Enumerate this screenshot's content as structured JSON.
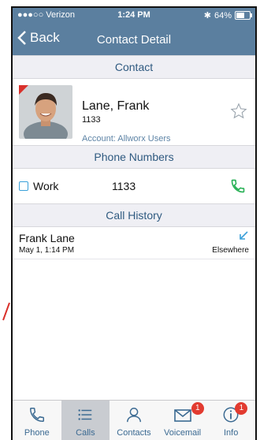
{
  "status_bar": {
    "carrier": "●●●○○ Verizon",
    "time": "1:24 PM",
    "battery": "64%",
    "battery_level": 0.64
  },
  "navbar": {
    "back_label": "Back",
    "title": "Contact Detail"
  },
  "contact_section": {
    "header": "Contact",
    "name": "Lane, Frank",
    "extension": "1133",
    "account": "Account: Allworx Users"
  },
  "phone_section": {
    "header": "Phone Numbers",
    "items": [
      {
        "type": "Work",
        "number": "1133"
      }
    ]
  },
  "history_section": {
    "header": "Call History",
    "items": [
      {
        "name": "Frank Lane",
        "date": "May 1, 1:14 PM",
        "location": "Elsewhere"
      }
    ]
  },
  "tabbar": {
    "tabs": [
      {
        "label": "Phone",
        "icon": "phone-icon"
      },
      {
        "label": "Calls",
        "icon": "list-icon",
        "active": true
      },
      {
        "label": "Contacts",
        "icon": "person-icon"
      },
      {
        "label": "Voicemail",
        "icon": "envelope-icon",
        "badge": "1"
      },
      {
        "label": "Info",
        "icon": "info-icon",
        "badge": "1"
      }
    ]
  },
  "colors": {
    "nav": "#5b7f9f",
    "accent": "#3b6a92",
    "call_green": "#2fb35b",
    "badge_red": "#e23b30"
  }
}
